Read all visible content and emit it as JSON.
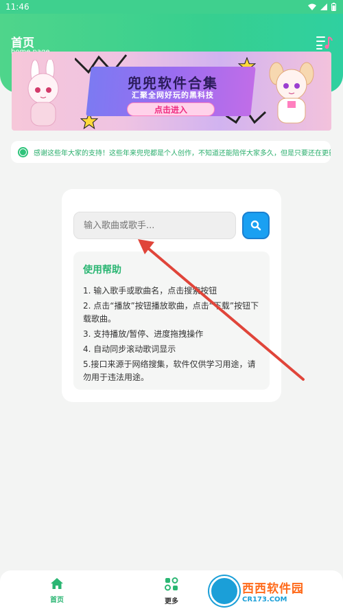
{
  "status_bar": {
    "time": "11:46"
  },
  "header": {
    "title": "首页",
    "subtitle": "home page",
    "menu_icon": "music-list-icon"
  },
  "banner": {
    "title": "兜兜软件合集",
    "subtitle": "汇聚全网好玩的黑科技",
    "cta": "点击进入"
  },
  "notice": {
    "text": "感谢这些年大家的支持！这些年来兜兜都是个人创作，不知道还能陪伴大家多久，但是只要还在更新"
  },
  "search": {
    "placeholder": "输入歌曲或歌手...",
    "button_icon": "search-icon"
  },
  "help": {
    "title": "使用帮助",
    "items": [
      "1. 输入歌手或歌曲名，点击搜索按钮",
      "2. 点击“播放”按钮播放歌曲，点击“下载”按钮下载歌曲。",
      "3. 支持播放/暂停、进度拖拽操作",
      "4. 自动同步滚动歌词显示",
      "5.接口来源于网络搜集，软件仅供学习用途，请勿用于违法用途。"
    ]
  },
  "bottom_nav": {
    "items": [
      {
        "label": "首页",
        "icon": "home-icon",
        "active": true
      },
      {
        "label": "更多",
        "icon": "apps-icon",
        "active": false
      }
    ]
  },
  "watermark": {
    "brand": "西西软件园",
    "url": "CR173.COM"
  },
  "colors": {
    "accent": "#2bb673",
    "header_green": "#3fd08e",
    "search_blue": "#1aa0f2",
    "annotation_red": "#e0453a"
  }
}
